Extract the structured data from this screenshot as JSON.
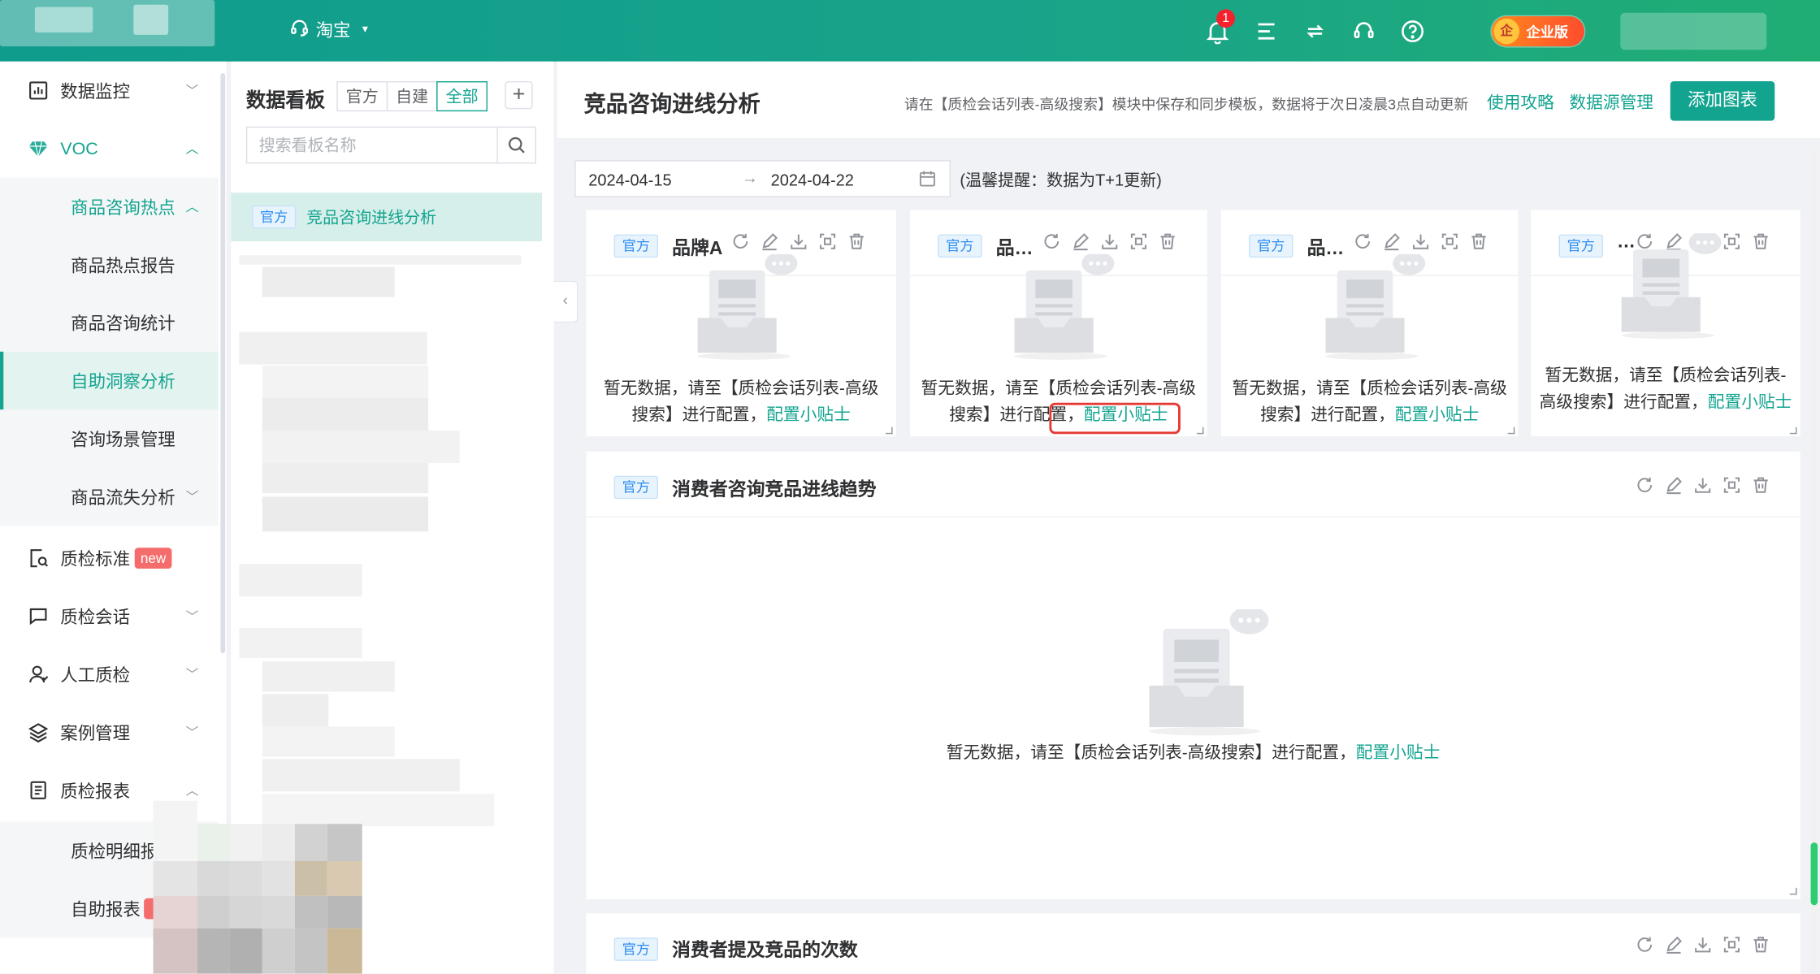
{
  "topbar": {
    "shop_name": "淘宝",
    "notification_count": "1",
    "edition_label": "企业版",
    "colors": {
      "bar_start": "#0f9c8c",
      "bar_end": "#20ad74"
    }
  },
  "sidebar": {
    "items": [
      {
        "label": "数据监控",
        "icon": "chart-icon"
      },
      {
        "label": "VOC",
        "icon": "diamond-icon"
      },
      {
        "label": "商品咨询热点"
      },
      {
        "label": "商品热点报告"
      },
      {
        "label": "商品咨询统计"
      },
      {
        "label": "自助洞察分析"
      },
      {
        "label": "咨询场景管理"
      },
      {
        "label": "商品流失分析"
      },
      {
        "label": "质检标准",
        "icon": "doc-search-icon",
        "badge": "new"
      },
      {
        "label": "质检会话",
        "icon": "chat-icon"
      },
      {
        "label": "人工质检",
        "icon": "user-icon"
      },
      {
        "label": "案例管理",
        "icon": "layers-icon"
      },
      {
        "label": "质检报表",
        "icon": "report-icon"
      },
      {
        "label": "质检明细报"
      },
      {
        "label": "自助报表"
      }
    ]
  },
  "boards": {
    "title": "数据看板",
    "tabs": [
      "官方",
      "自建",
      "全部"
    ],
    "active_tab": "全部",
    "add_label": "+",
    "search_placeholder": "搜索看板名称",
    "items": [
      {
        "tag": "官方",
        "name": "竞品咨询进线分析"
      }
    ]
  },
  "main": {
    "page_title": "竞品咨询进线分析",
    "notice": "请在【质检会话列表-高级搜索】模块中保存和同步模板，数据将于次日凌晨3点自动更新",
    "guide_link": "使用攻略",
    "datasource_link": "数据源管理",
    "add_chart_label": "添加图表",
    "date_start": "2024-04-15",
    "date_arrow": "→",
    "date_end": "2024-04-22",
    "tip": "(温馨提醒：数据为T+1更新)",
    "empty_prefix": "暂无数据，请至【质检会话列表-高级搜索】进行配置，",
    "empty_link": "配置小贴士",
    "small_cards": [
      {
        "tag": "官方",
        "title": "品牌A"
      },
      {
        "tag": "官方",
        "title": "品…"
      },
      {
        "tag": "官方",
        "title": "品…"
      },
      {
        "tag": "官方",
        "title": "…"
      }
    ],
    "big_cards": [
      {
        "tag": "官方",
        "title": "消费者咨询竞品进线趋势"
      },
      {
        "tag": "官方",
        "title": "消费者提及竞品的次数"
      }
    ],
    "accent_color": "#13a490"
  }
}
